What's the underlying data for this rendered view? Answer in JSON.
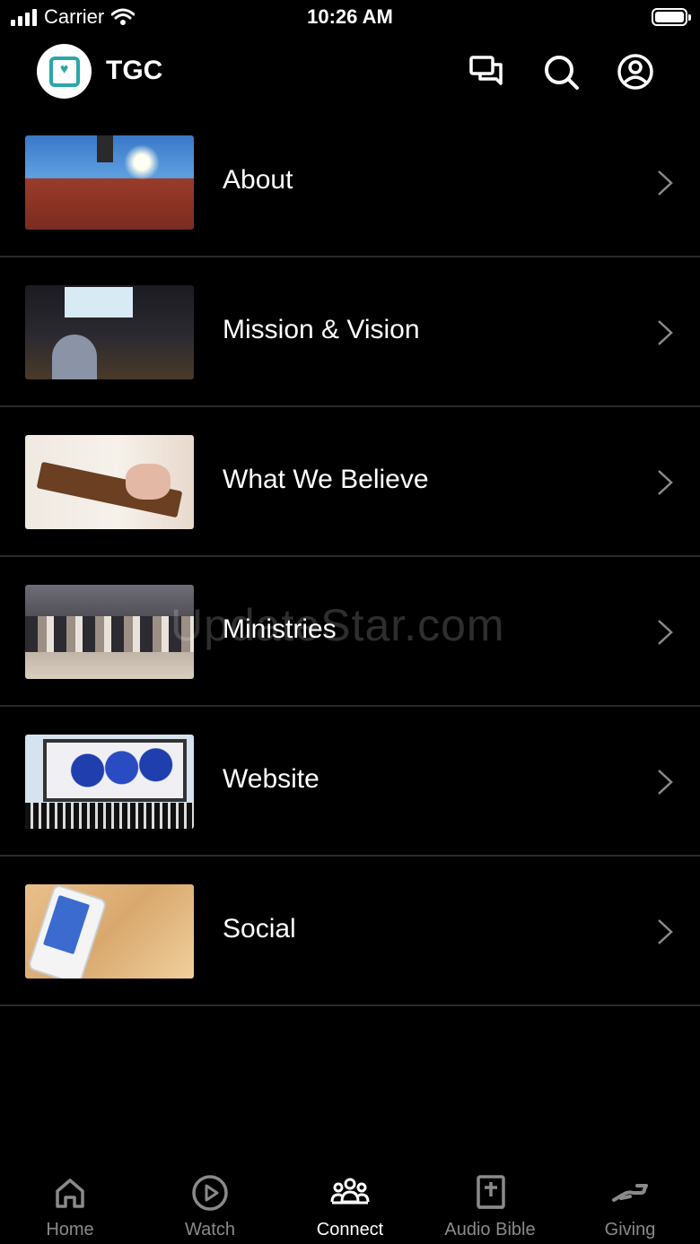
{
  "status": {
    "carrier": "Carrier",
    "time": "10:26 AM"
  },
  "header": {
    "title": "TGC",
    "icons": [
      "chat-icon",
      "search-icon",
      "account-icon"
    ]
  },
  "rows": [
    {
      "label": "About",
      "thumb": "church-building-photo"
    },
    {
      "label": "Mission & Vision",
      "thumb": "worship-service-photo"
    },
    {
      "label": "What We Believe",
      "thumb": "open-bible-photo"
    },
    {
      "label": "Ministries",
      "thumb": "fellowship-meal-photo"
    },
    {
      "label": "Website",
      "thumb": "web-puzzle-laptop-photo"
    },
    {
      "label": "Social",
      "thumb": "smartphone-in-hand-photo"
    }
  ],
  "watermark": "UpdateStar.com",
  "tabbar": {
    "active": "Connect",
    "tabs": [
      {
        "label": "Home",
        "icon": "home-icon"
      },
      {
        "label": "Watch",
        "icon": "play-circle-icon"
      },
      {
        "label": "Connect",
        "icon": "group-icon"
      },
      {
        "label": "Audio Bible",
        "icon": "bible-icon"
      },
      {
        "label": "Giving",
        "icon": "giving-hand-icon"
      }
    ]
  },
  "colors": {
    "background": "#000000",
    "text": "#ffffff",
    "inactive_tab": "#8a8a8a",
    "brand": "#2aa7a8",
    "divider": "#2a2a2a"
  }
}
